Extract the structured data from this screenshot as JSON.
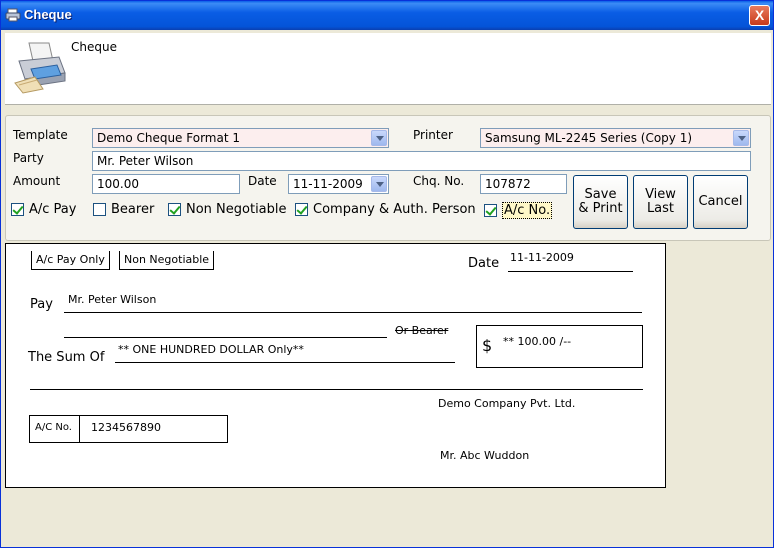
{
  "window": {
    "title": "Cheque",
    "close_glyph": "X"
  },
  "header": {
    "title": "Cheque",
    "icon": "printer-icon"
  },
  "form": {
    "template_label": "Template",
    "template_value": "Demo Cheque Format 1",
    "printer_label": "Printer",
    "printer_value": "Samsung ML-2245 Series (Copy 1)",
    "party_label": "Party",
    "party_value": "Mr. Peter Wilson",
    "amount_label": "Amount",
    "amount_value": "100.00",
    "date_label": "Date",
    "date_value": "11-11-2009",
    "chq_label": "Chq. No.",
    "chq_value": "107872",
    "checkboxes": [
      {
        "label": "A/c Pay",
        "checked": true
      },
      {
        "label": "Bearer",
        "checked": false
      },
      {
        "label": "Non Negotiable",
        "checked": true
      },
      {
        "label": "Company & Auth. Person",
        "checked": true
      },
      {
        "label": "A/c No.",
        "checked": true
      }
    ],
    "buttons": {
      "save_print": "Save\n& Print",
      "view_last": "View\nLast",
      "cancel": "Cancel"
    }
  },
  "cheque": {
    "ac_pay_only": "A/c Pay Only",
    "non_negotiable": "Non Negotiable",
    "date_label": "Date",
    "date_value": "11-11-2009",
    "pay_label": "Pay",
    "payee": "Mr. Peter Wilson",
    "or_bearer": "Or Bearer",
    "sum_label": "The Sum Of",
    "sum_words": "** ONE HUNDRED  DOLLAR Only**",
    "currency_symbol": "$",
    "amount_figure": "** 100.00 /--",
    "company": "Demo Company Pvt. Ltd.",
    "ac_no_label": "A/C No.",
    "ac_no_value": "1234567890",
    "signatory": "Mr. Abc Wuddon"
  }
}
